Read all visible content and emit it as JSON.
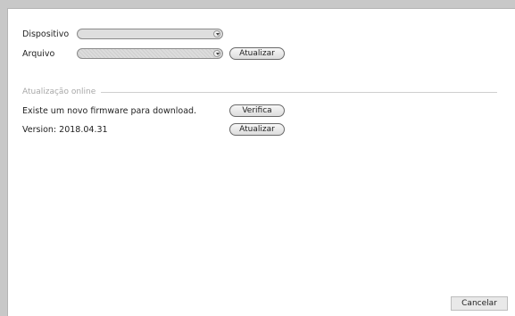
{
  "form": {
    "device_label": "Dispositivo",
    "device_value": "",
    "file_label": "Arquivo",
    "file_value": "",
    "update_file_button": "Atualizar"
  },
  "online": {
    "section_title": "Atualização online",
    "status_text": "Existe um novo firmware para download.",
    "check_button": "Verifica",
    "version_text": "Version: 2018.04.31",
    "update_button": "Atualizar"
  },
  "footer": {
    "cancel_button": "Cancelar"
  },
  "icons": {
    "dropdown": "chevron-down-icon"
  }
}
